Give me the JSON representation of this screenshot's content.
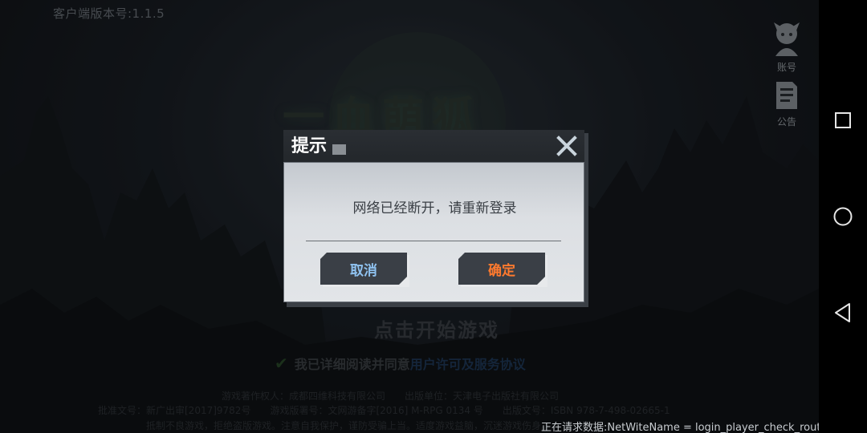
{
  "client_version": "客户端版本号:1.1.5",
  "side_buttons": {
    "account_label": "账号",
    "notice_label": "公告"
  },
  "logo_text": "一血萌狐",
  "start_prompt": "点击开始游戏",
  "agreement": {
    "checked": true,
    "text": "我已详细阅读并同意",
    "link": "用户许可及服务协议"
  },
  "info_lines": [
    "游戏著作权人：成都四维科技有限公司　　出版单位：天津电子出版社有限公司",
    "批准文号：新广出审[2017]9782号　　游戏版署号：文网游备字[2016] M-RPG 0134 号　　出版文号：ISBN 978-7-498-02665-1",
    "抵制不良游戏，拒绝盗版游戏。注意自我保护，谨防受骗上当。适度游戏益脑，沉迷游戏伤身。"
  ],
  "status_line": "正在请求数据:NetWiteName = login_player_check_router",
  "dialog": {
    "title": "提示",
    "message": "网络已经断开，请重新登录",
    "cancel_label": "取消",
    "confirm_label": "确定"
  },
  "icons": [
    "close-icon",
    "account-icon",
    "notice-icon",
    "check-icon",
    "recent-apps-icon",
    "home-icon",
    "back-icon"
  ],
  "colors": {
    "confirm": "#ff7a2e",
    "cancel": "#8fc2f0",
    "dialog_header": "#23272b",
    "dialog_body": "#dcdfe3"
  }
}
